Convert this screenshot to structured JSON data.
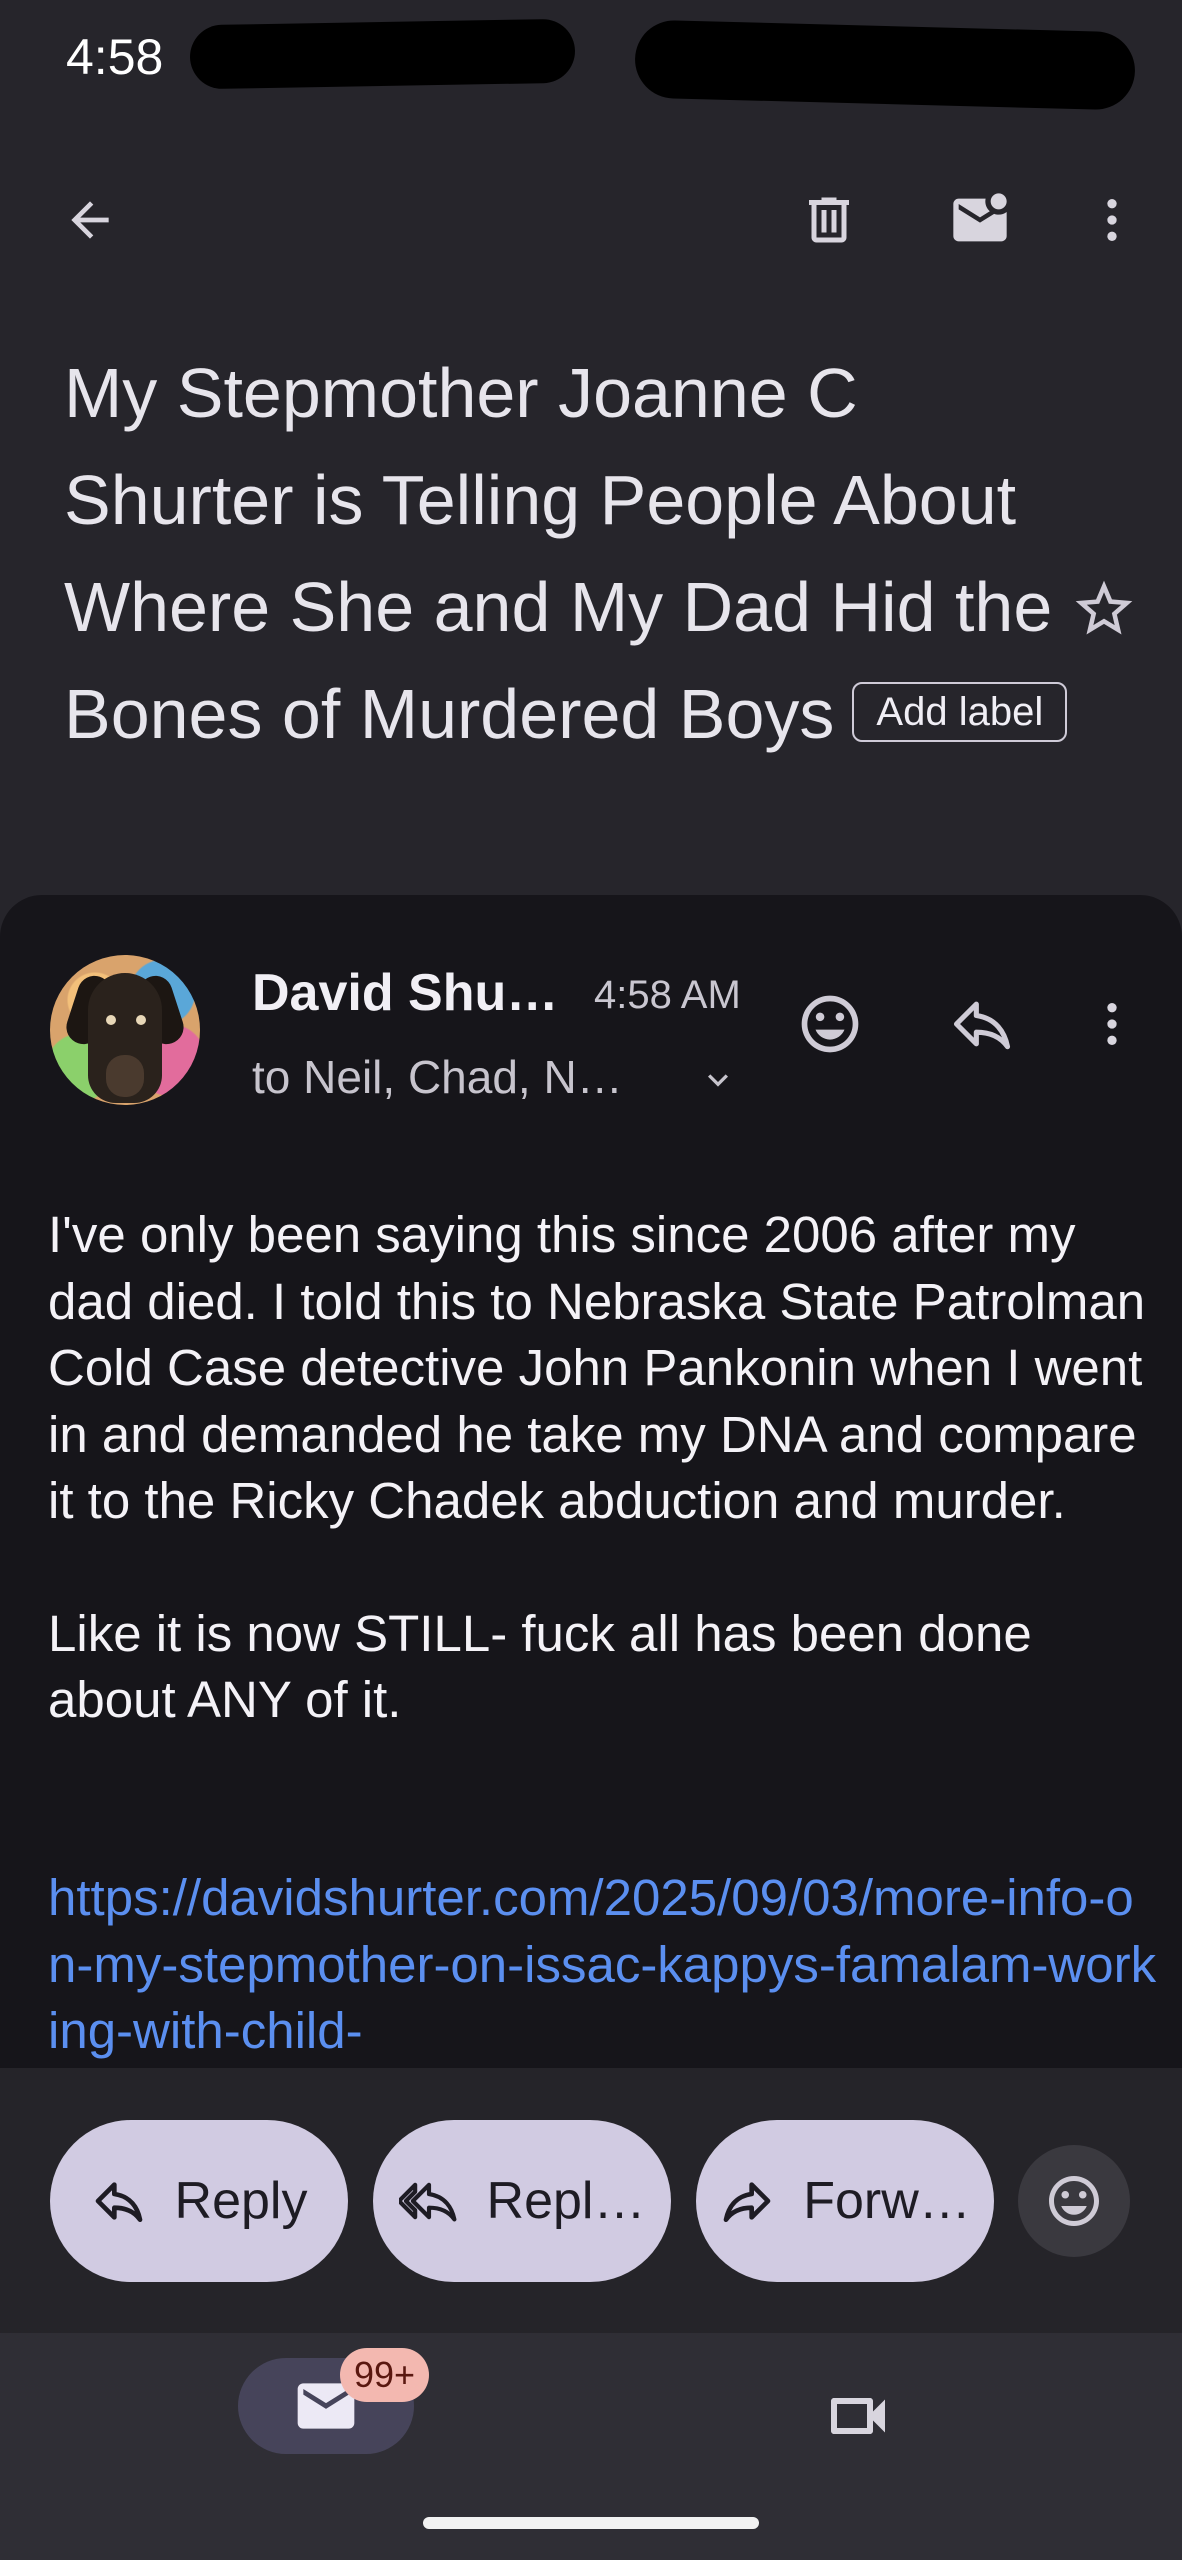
{
  "status_bar": {
    "time": "4:58"
  },
  "toolbar": {
    "back_icon": "arrow-back-icon",
    "delete_icon": "trash-icon",
    "mark_unread_icon": "mail-unread-icon",
    "more_icon": "more-vert-icon"
  },
  "email": {
    "subject": "My Stepmother Joanne C Shurter is Telling People About Where She and My Dad Hid the Bones of Murdered Boys",
    "add_label": "Add label",
    "starred": false
  },
  "message": {
    "sender": "David Shu…",
    "time": "4:58 AM",
    "recipients": "to Neil, Chad, N…",
    "paragraphs": [
      "I've only been saying this since 2006 after my dad died. I told this to Nebraska State Patrolman Cold Case detective John Pankonin when I went in and demanded he take my DNA and compare it to the Ricky Chadek abduction and murder.",
      "Like it is now STILL- fuck all has been done about ANY of it."
    ],
    "link": "https://davidshurter.com/2025/09/03/more-info-on-my-stepmother-on-issac-kappys-famalam-working-with-child-"
  },
  "actions": {
    "reply": "Reply",
    "reply_all": "Repl…",
    "forward": "Forw…"
  },
  "bottom_nav": {
    "mail_badge": "99+",
    "mail_icon": "mail-icon",
    "meet_icon": "video-camera-icon"
  },
  "colors": {
    "background": "#26252b",
    "card": "#16151a",
    "pill": "#d1cbe2",
    "link": "#5b8ff0",
    "badge": "#f3b8b0"
  }
}
